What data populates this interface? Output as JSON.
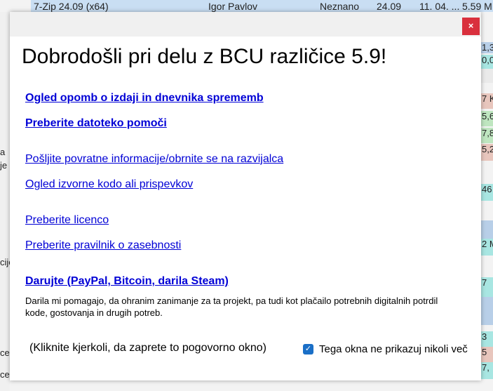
{
  "background": {
    "top_row": {
      "name": "7-Zip 24.09 (x64)",
      "publisher": "Igor Pavlov",
      "status": "Neznano",
      "version": "24.09",
      "date": "11. 04. ...",
      "size": "5.59 M"
    },
    "right_cells": [
      "1,3",
      "0,0",
      "",
      "7 K",
      "5,6",
      "7,8",
      "5,2",
      "46",
      "",
      "2 M",
      "7",
      "",
      "3",
      "5",
      "7,"
    ],
    "left_fragments": [
      "a",
      "je",
      "cije",
      "ce",
      "ce"
    ]
  },
  "dialog": {
    "close_label": "×",
    "title": "Dobrodošli pri delu z BCU različice 5.9!",
    "links": [
      {
        "label": "Ogled opomb o izdaji in dnevnika sprememb"
      },
      {
        "label": "Preberite datoteko pomoči"
      },
      {
        "label": "Pošljite povratne informacije/obrnite se na razvijalca"
      },
      {
        "label": "Ogled izvorne kodo ali prispevkov"
      },
      {
        "label": "Preberite licenco"
      },
      {
        "label": "Preberite pravilnik o zasebnosti"
      },
      {
        "label": "Darujte (PayPal, Bitcoin, darila Steam)"
      }
    ],
    "donate_description": "Darila mi pomagajo, da ohranim zanimanje za ta projekt, pa tudi kot plačailo potrebnih digitalnih potrdil kode, gostovanja in drugih potreb.",
    "footer_hint": "(Kliknite kjerkoli, da zaprete to pogovorno okno)",
    "dont_show_again": {
      "label": "Tega okna ne prikazuj nikoli več",
      "checked": true
    }
  }
}
